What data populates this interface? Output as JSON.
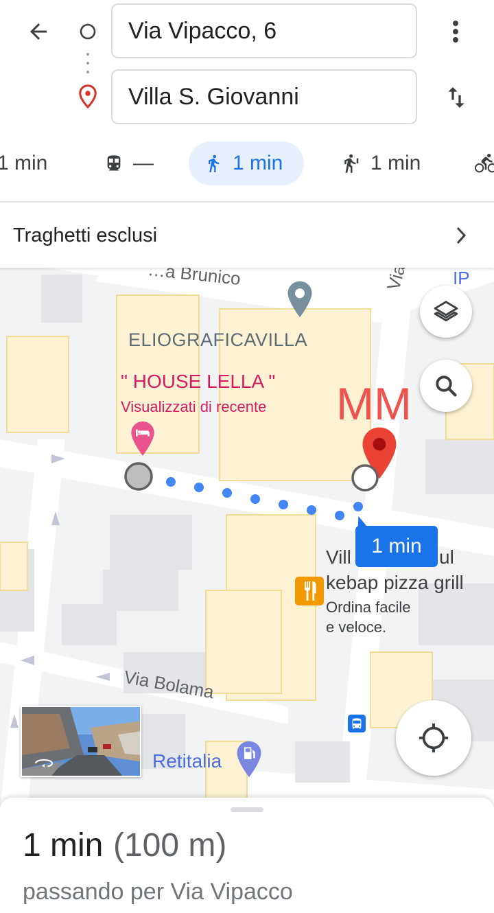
{
  "header": {
    "origin": "Via Vipacco, 6",
    "destination": "Villa S. Giovanni",
    "icons": {
      "back": "arrow-back-icon",
      "more": "more-vert-icon",
      "swap": "swap-vert-icon"
    }
  },
  "modes": [
    {
      "id": "drive",
      "label": "1 min",
      "icon": "car-icon"
    },
    {
      "id": "transit",
      "label": "—",
      "icon": "train-icon"
    },
    {
      "id": "walk",
      "label": "1 min",
      "icon": "walk-icon",
      "selected": true
    },
    {
      "id": "ride",
      "label": "1 min",
      "icon": "ride-hailing-icon"
    },
    {
      "id": "bike",
      "label": "",
      "icon": "bike-icon"
    }
  ],
  "options": {
    "label": "Traghetti esclusi"
  },
  "map": {
    "streets": [
      "…a Brunico",
      "Viale M",
      "Via Bolama"
    ],
    "places": {
      "eliografica": "ELIOGRAFICAVILLA",
      "house": "\" HOUSE LELLA \"",
      "house_sub": "Visualizzati di recente",
      "mm": "MM",
      "kebab_line1": "Vill",
      "kebab_line1b": "ul",
      "kebab_line2": "kebap pizza grill",
      "kebab_sub1": "Ordina facile",
      "kebab_sub2": "e veloce.",
      "retitalia": "Retitalia",
      "ip": "IP"
    },
    "route_badge": "1 min",
    "colors": {
      "route": "#4285f4",
      "badge": "#1a73e8",
      "pin_red": "#ea4335",
      "pin_pink": "#e8548b",
      "building": "#fdf3d4"
    }
  },
  "sheet": {
    "duration": "1 min",
    "distance": "(100 m)",
    "via": "passando per Via Vipacco"
  }
}
